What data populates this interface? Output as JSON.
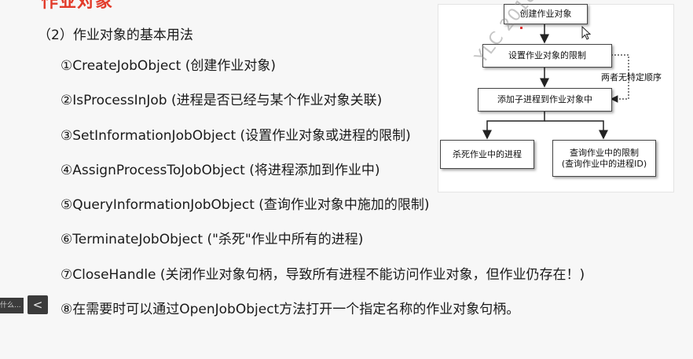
{
  "slide": {
    "title_fragment": "作业对象",
    "subtitle": "（2）作业对象的基本用法",
    "items": [
      "①CreateJobObject (创建作业对象)",
      "②IsProcessInJob (进程是否已经与某个作业对象关联)",
      "③SetInformationJobObject (设置作业对象或进程的限制)",
      "④AssignProcessToJobObject (将进程添加到作业中)",
      "⑤QueryInformationJobObject (查询作业对象中施加的限制)",
      "⑥TerminateJobObject (\"杀死\"作业中所有的进程)",
      "⑦CloseHandle (关闭作业对象句柄，导致所有进程不能访问作业对象，但作业仍存在！)",
      "⑧在需要时可以通过OpenJobObject方法打开一个指定名称的作业对象句柄。"
    ]
  },
  "flowchart": {
    "create": "创建作业对象",
    "set_limits": "设置作业对象的限制",
    "add_process": "添加子进程到作业对象中",
    "kill": "杀死作业中的进程",
    "query_line1": "查询作业中的限制",
    "query_line2": "(查询作业中的进程ID)",
    "no_order_label": "两者无特定顺序"
  },
  "watermark": "YLC 2018200123005",
  "player": {
    "left_tag": "什么...",
    "prev_icon": "chevron-left-icon",
    "prev_symbol": "<"
  },
  "colors": {
    "title_red": "#e23b2a",
    "dark_control": "#3b3b3b"
  }
}
